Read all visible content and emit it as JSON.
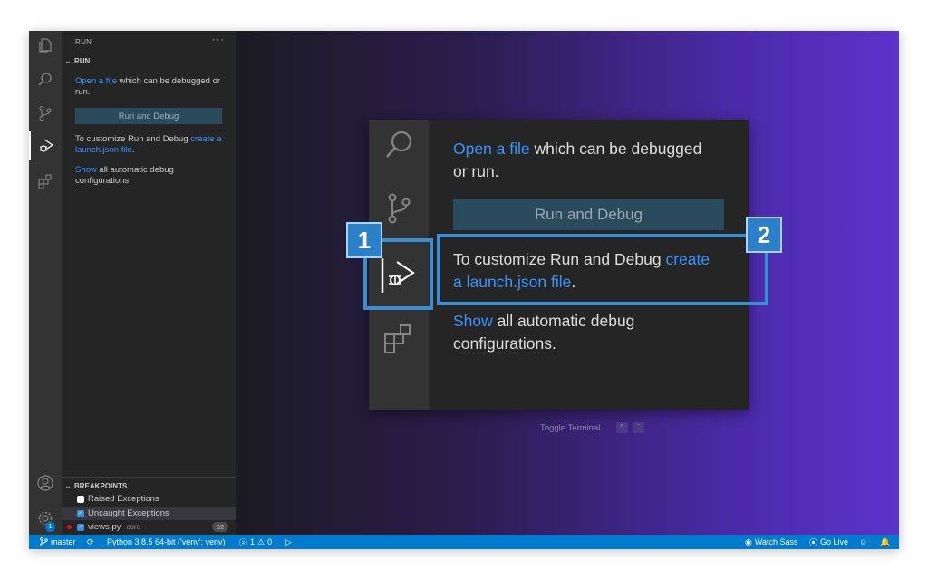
{
  "sidebar": {
    "title": "RUN",
    "more": "···",
    "run_section": "RUN",
    "welcome": {
      "open_link": "Open a file",
      "open_rest": " which can be debugged or run.",
      "button": "Run and Debug",
      "customize_text": "To customize Run and Debug ",
      "customize_link": "create a launch.json file",
      "customize_end": ".",
      "show_link": "Show",
      "show_rest": " all automatic debug configurations."
    },
    "breakpoints": {
      "header": "BREAKPOINTS",
      "items": [
        {
          "label": "Raised Exceptions",
          "checked": false
        },
        {
          "label": "Uncaught Exceptions",
          "checked": true
        },
        {
          "label": "views.py",
          "path": "core",
          "count": "92",
          "checked": true
        }
      ]
    }
  },
  "activity_bar": {
    "icons": [
      "files-icon",
      "search-icon",
      "source-control-icon",
      "run-debug-icon",
      "extensions-icon"
    ],
    "bottom_icons": [
      "account-icon",
      "settings-gear-icon"
    ],
    "settings_badge": "1"
  },
  "callout": {
    "open_link": "Open a file",
    "open_rest": " which can be debugged",
    "open_rest2": "or run.",
    "button": "Run and Debug",
    "customize_text": "To customize Run and Debug ",
    "customize_link1": "create",
    "customize_link2": "a launch.json file",
    "customize_end": ".",
    "show_link": "Show",
    "show_rest": " all automatic debug",
    "show_rest2": "configurations.",
    "badge1": "1",
    "badge2": "2",
    "highlight_color": "#3b8fd0"
  },
  "editor": {
    "toggle_terminal": "Toggle Terminal",
    "key1": "^",
    "key2": "`"
  },
  "status_bar": {
    "branch": "master",
    "python": "Python 3.8.5 64-bit ('venv': venv)",
    "errors": "1",
    "warnings": "0",
    "watch_sass": "Watch Sass",
    "go_live": "Go Live",
    "color": "#007acc"
  }
}
